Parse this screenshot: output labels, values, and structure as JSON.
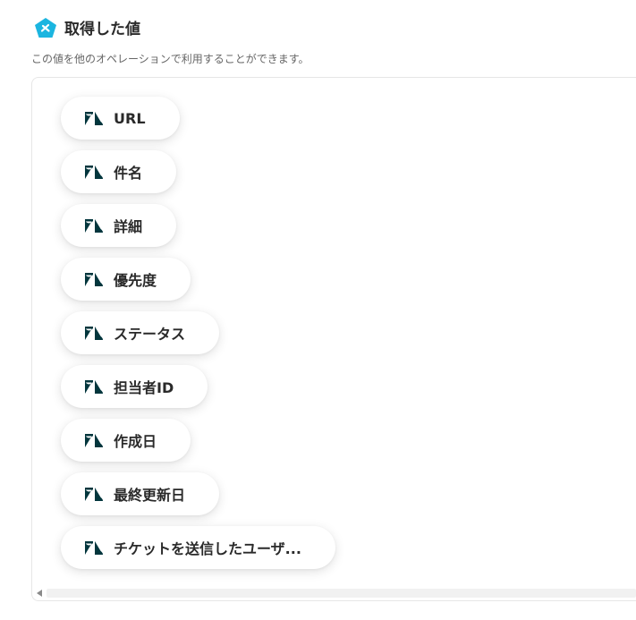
{
  "header": {
    "title": "取得した値",
    "subtitle": "この値を他のオペレーションで利用することができます。",
    "badge_color": "#1bb5e0"
  },
  "chips": [
    {
      "label": "URL",
      "icon": "zendesk-icon"
    },
    {
      "label": "件名",
      "icon": "zendesk-icon"
    },
    {
      "label": "詳細",
      "icon": "zendesk-icon"
    },
    {
      "label": "優先度",
      "icon": "zendesk-icon"
    },
    {
      "label": "ステータス",
      "icon": "zendesk-icon"
    },
    {
      "label": "担当者ID",
      "icon": "zendesk-icon"
    },
    {
      "label": "作成日",
      "icon": "zendesk-icon"
    },
    {
      "label": "最終更新日",
      "icon": "zendesk-icon"
    },
    {
      "label": "チケットを送信したユーザ...",
      "icon": "zendesk-icon"
    }
  ],
  "colors": {
    "icon": "#03363d",
    "chip_text": "#2a2a2a"
  }
}
